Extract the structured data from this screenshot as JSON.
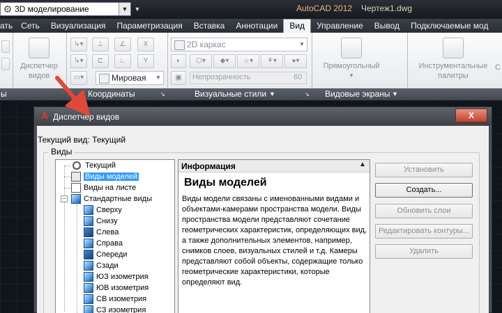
{
  "titlebar": {
    "workspace": "3D моделирование",
    "app_title": "AutoCAD 2012",
    "doc_title": "Чертеж1.dwg"
  },
  "ribbon": {
    "tabs": [
      {
        "label": "ать",
        "active": false
      },
      {
        "label": "Сеть",
        "active": false
      },
      {
        "label": "Визуализация",
        "active": false
      },
      {
        "label": "Параметризация",
        "active": false
      },
      {
        "label": "Вставка",
        "active": false
      },
      {
        "label": "Аннотации",
        "active": false
      },
      {
        "label": "Вид",
        "active": true
      },
      {
        "label": "Управление",
        "active": false
      },
      {
        "label": "Вывод",
        "active": false
      },
      {
        "label": "Подключаемые мод",
        "active": false
      }
    ],
    "view_manager_label": "Диспетчер видов",
    "ucs_combo": "Мировая",
    "visual_style_combo": "2D каркас",
    "opacity_label": "Непрозрачность",
    "opacity_value": "60",
    "viewport_label": "Прямоугольный",
    "palettes_label": "Инструментальные палитры",
    "panels": {
      "coordinates": "Координаты",
      "visual_styles": "Визуальные стили",
      "viewports": "Видовые экраны",
      "left_stub": "ы"
    }
  },
  "dialog": {
    "title": "Диспетчер видов",
    "close_label": "X",
    "current_view": "Текущий вид: Текущий",
    "group_label": "Виды",
    "tree": [
      {
        "label": "Текущий"
      },
      {
        "label": "Виды моделей",
        "selected": true
      },
      {
        "label": "Виды на листе"
      },
      {
        "label": "Стандартные виды"
      },
      {
        "label": "Сверху"
      },
      {
        "label": "Снизу"
      },
      {
        "label": "Слева"
      },
      {
        "label": "Справа"
      },
      {
        "label": "Спереди"
      },
      {
        "label": "Сзади"
      },
      {
        "label": "ЮЗ изометрия"
      },
      {
        "label": "ЮВ изометрия"
      },
      {
        "label": "СВ изометрия"
      },
      {
        "label": "СЗ изометрия"
      }
    ],
    "info": {
      "header": "Информация",
      "heading": "Виды моделей",
      "text": "Виды модели связаны с именованными видами и объектами-камерами пространства модели. Виды пространства модели представляют сочетание геометрических характеристик, определяющих вид, а также дополнительных элементов, например, снимков слоев, визуальных стилей и т.д. Камеры представляют собой объекты, содержащие только геометрические характеристики, которые определяют вид."
    },
    "buttons": [
      {
        "label": "Установить",
        "enabled": false
      },
      {
        "label": "Создать...",
        "enabled": true
      },
      {
        "label": "Обновить слои",
        "enabled": false
      },
      {
        "label": "Редактировать контуры...",
        "enabled": false
      },
      {
        "label": "Удалить",
        "enabled": false
      }
    ]
  },
  "colors": {
    "annotation_arrow": "#e0483a",
    "selection": "#3399ff",
    "title_accent": "#e7b48c"
  }
}
